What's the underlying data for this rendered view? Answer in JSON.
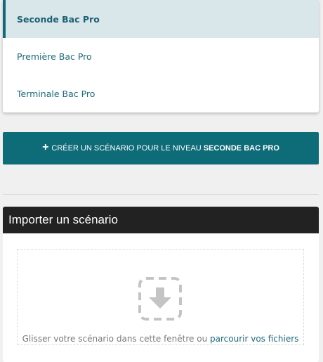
{
  "levels": {
    "items": [
      {
        "label": "Seconde Bac Pro",
        "active": true
      },
      {
        "label": "Première Bac Pro",
        "active": false
      },
      {
        "label": "Terminale Bac Pro",
        "active": false
      }
    ]
  },
  "create_button": {
    "icon": "plus-icon",
    "plus_glyph": "+",
    "label_prefix": "CRÉER UN SCÉNARIO POUR LE NIVEAU",
    "level_name": "SECONDE BAC PRO"
  },
  "import_panel": {
    "title": "Importer un scénario",
    "drop_icon": "upload-arrow-icon",
    "drop_text": "Glisser votre scénario dans cette fenêtre ou",
    "browse_link": "parcourir vos fichiers"
  },
  "colors": {
    "accent": "#0e6b78",
    "active_bg": "#d9e6ea",
    "header_bg": "#222222",
    "link": "#1d6a79",
    "page_bg": "#f0f0f0"
  }
}
